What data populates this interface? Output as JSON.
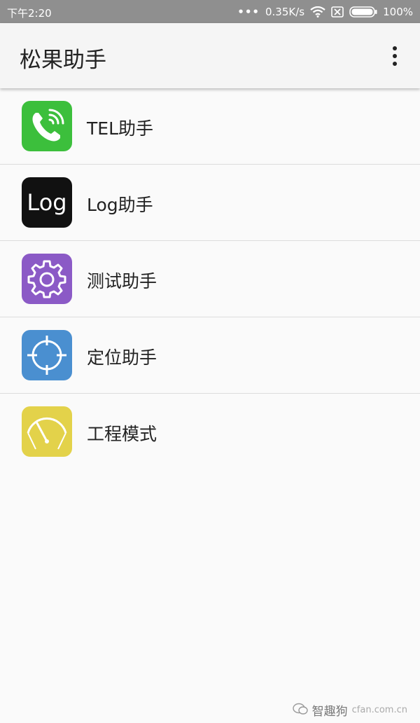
{
  "status_bar": {
    "time": "下午2:20",
    "dots": "•••",
    "network_speed": "0.35K/s",
    "battery": "100%"
  },
  "app_bar": {
    "title": "松果助手"
  },
  "items": [
    {
      "label": "TEL助手",
      "icon": "phone-icon",
      "color": "#3cbf3c"
    },
    {
      "label": "Log助手",
      "icon": "log-icon",
      "color": "#111111",
      "icon_text": "Log"
    },
    {
      "label": "测试助手",
      "icon": "gear-icon",
      "color": "#8b5ac6"
    },
    {
      "label": "定位助手",
      "icon": "crosshair-icon",
      "color": "#4a8fd0"
    },
    {
      "label": "工程模式",
      "icon": "gauge-icon",
      "color": "#e3d24a"
    }
  ],
  "watermark": {
    "name": "智趣狗",
    "site": "cfan.com.cn"
  }
}
